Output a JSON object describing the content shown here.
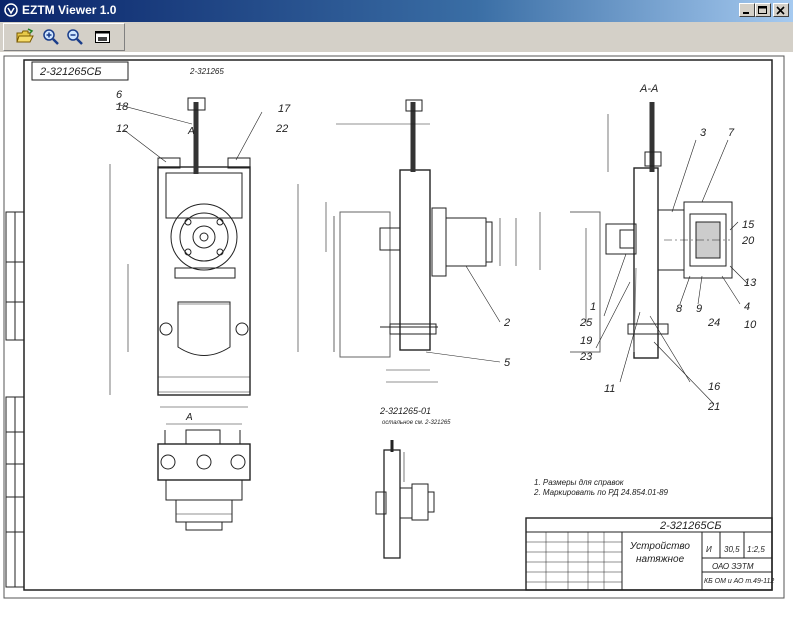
{
  "window": {
    "title": "EZTM Viewer 1.0"
  },
  "controls": {
    "minimize": "minimize",
    "maximize": "maximize",
    "close": "close"
  },
  "toolbar": {
    "tools": [
      "open-folder-icon",
      "zoom-in-icon",
      "zoom-out-icon",
      "fit-window-icon"
    ]
  },
  "drawing": {
    "corner_stamp": "2-321265СБ",
    "top_ref": "2-321265",
    "section_mark": "A",
    "section_title": "А-А",
    "sub_title": "2-321265-01",
    "sub_note": "остальное см. 2-321265",
    "notes": [
      "1. Размеры для справок",
      "2. Маркировать по РД 24.854.01-89"
    ],
    "title_block": {
      "code": "2-321265СБ",
      "name_line1": "Устройство",
      "name_line2": "натяжное",
      "letter": "И",
      "mass": "30,5",
      "scale": "1:2,5",
      "org": "ОАО ЗЭТМ",
      "org2": "КБ ОМ и АО т.49-112"
    },
    "callouts": [
      "6",
      "18",
      "17",
      "12",
      "22",
      "2",
      "5",
      "3",
      "7",
      "15",
      "20",
      "13",
      "4",
      "10",
      "1",
      "25",
      "19",
      "23",
      "8",
      "9",
      "24",
      "11",
      "16",
      "21"
    ]
  }
}
